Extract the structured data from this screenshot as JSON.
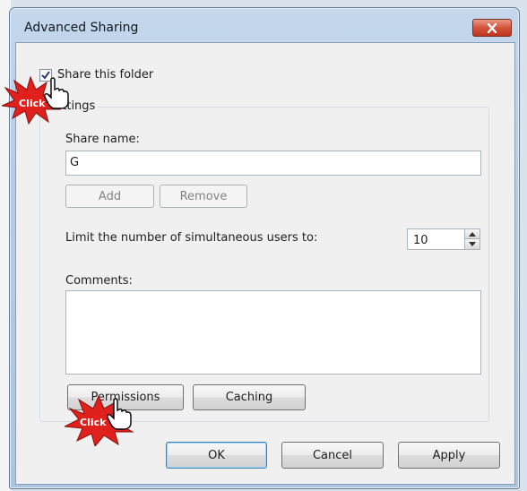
{
  "window": {
    "title": "Advanced Sharing",
    "close_icon": "close-icon"
  },
  "share_checkbox": {
    "label": "Share this folder",
    "checked": true
  },
  "settings": {
    "group_label": "Settings",
    "share_name_label": "Share name:",
    "share_name_value": "G",
    "add_label": "Add",
    "remove_label": "Remove",
    "limit_label": "Limit the number of simultaneous users to:",
    "limit_value": "10",
    "comments_label": "Comments:",
    "comments_value": "",
    "permissions_label": "Permissions",
    "caching_label": "Caching"
  },
  "footer": {
    "ok_label": "OK",
    "cancel_label": "Cancel",
    "apply_label": "Apply"
  },
  "annotations": {
    "click_1": "Click",
    "click_2": "Click"
  },
  "colors": {
    "burst_red": "#e0201c",
    "close_red": "#c0341d",
    "title_blue": "#b6cbe3"
  }
}
